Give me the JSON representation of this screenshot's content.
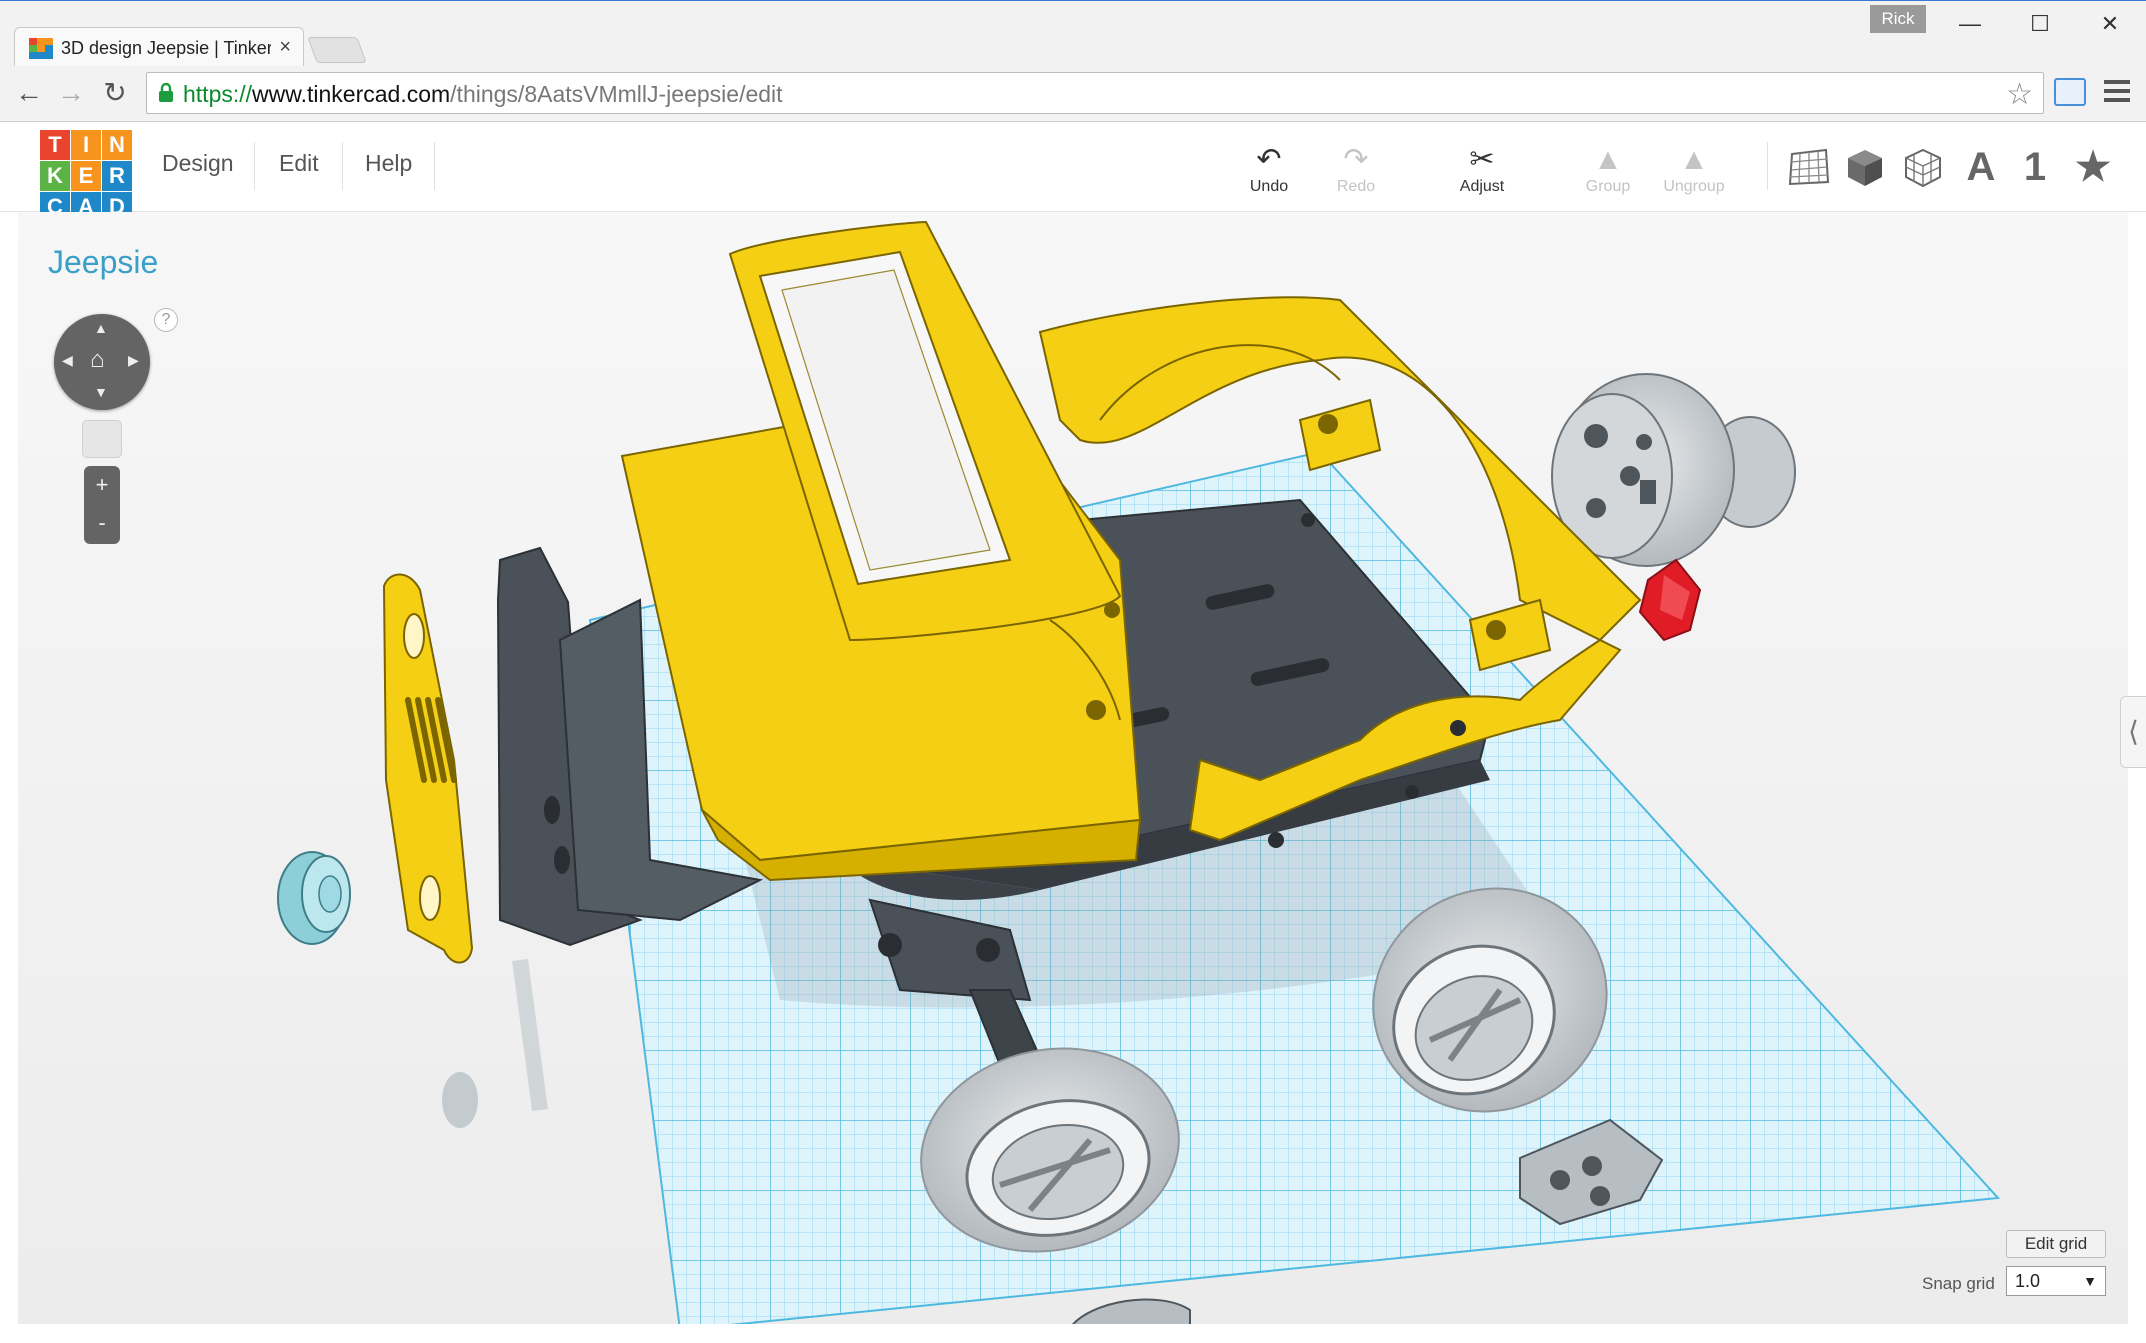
{
  "browser": {
    "tab_title": "3D design Jeepsie | Tinker",
    "tab_close": "×",
    "user_badge": "Rick",
    "window_controls": {
      "minimize": "—",
      "maximize": "☐",
      "close": "✕"
    },
    "nav": {
      "back": "←",
      "forward": "→",
      "reload": "↻"
    },
    "url": {
      "scheme": "https://",
      "host": "www.tinkercad.com",
      "path": "/things/8AatsVMmllJ-jeepsie/edit"
    },
    "bookmark_icon": "star-outline-icon"
  },
  "app": {
    "logo_letters": [
      "T",
      "I",
      "N",
      "K",
      "E",
      "R",
      "C",
      "A",
      "D"
    ],
    "logo_colors": [
      "#e8442e",
      "#f7941d",
      "#f7941d",
      "#5bb346",
      "#f7941d",
      "#1e88c9",
      "#1e88c9",
      "#1e88c9",
      "#1e88c9"
    ],
    "menu": [
      "Design",
      "Edit",
      "Help"
    ],
    "tools": [
      {
        "label": "Undo",
        "glyph": "↶",
        "enabled": true
      },
      {
        "label": "Redo",
        "glyph": "↷",
        "enabled": false
      },
      {
        "label": "Adjust",
        "glyph": "✂",
        "enabled": true
      },
      {
        "label": "Group",
        "glyph": "▲",
        "enabled": false
      },
      {
        "label": "Ungroup",
        "glyph": "▲",
        "enabled": false
      }
    ],
    "view_icons": [
      "grid-icon",
      "solid-cube-icon",
      "wireframe-cube-icon",
      "text-icon",
      "number-icon",
      "star-icon"
    ],
    "view_glyphs": {
      "text": "A",
      "number": "1",
      "star": "★"
    }
  },
  "workspace": {
    "design_name": "Jeepsie",
    "help_mark": "?",
    "zoom_in": "+",
    "zoom_out": "-",
    "side_panel_toggle": "⟨",
    "edit_grid_label": "Edit grid",
    "snap_grid_label": "Snap grid",
    "snap_grid_value": "1.0",
    "accent_color": "#3aa0c8",
    "part_colors": {
      "body": "#f5cf14",
      "chassis": "#4a5158",
      "tires": "#c9cdd1",
      "headlight": "#9fd9e3",
      "light": "#e01c26",
      "grid": "#7fd0ec"
    }
  }
}
